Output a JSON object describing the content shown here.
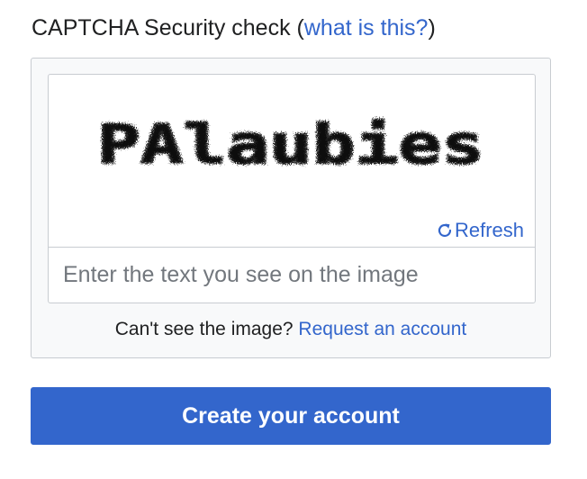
{
  "captcha_section": {
    "title": "CAPTCHA Security check",
    "open_paren": "(",
    "help_link": "what is this?",
    "close_paren": ")",
    "captcha_text": "PAlaubies",
    "refresh_label": "Refresh",
    "input_placeholder": "Enter the text you see on the image",
    "input_value": "",
    "cant_see_text": "Can't see the image?",
    "request_account_link": "Request an account"
  },
  "form": {
    "submit_label": "Create your account"
  },
  "colors": {
    "link": "#3366cc",
    "button_bg": "#3366cc",
    "panel_bg": "#f8f9fa",
    "border": "#c8ccd1"
  },
  "icons": {
    "refresh": "refresh-icon"
  }
}
